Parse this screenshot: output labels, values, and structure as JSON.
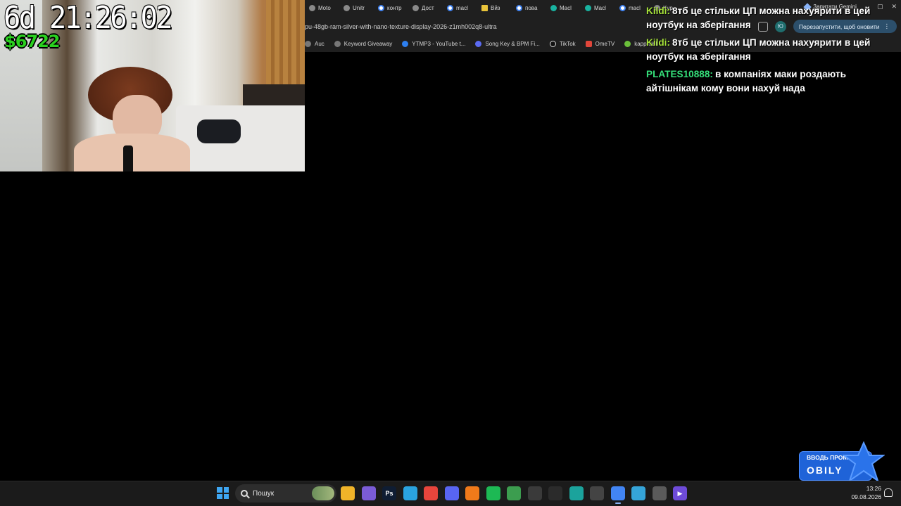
{
  "browser": {
    "tabs": [
      {
        "label": "Moto",
        "icon": "generic-favicon-icon",
        "style": "default"
      },
      {
        "label": "Unitr",
        "icon": "generic-favicon-icon",
        "style": "default"
      },
      {
        "label": "контр",
        "icon": "google-favicon-icon",
        "style": "g"
      },
      {
        "label": "Дост",
        "icon": "generic-favicon-icon",
        "style": "default"
      },
      {
        "label": "macl",
        "icon": "google-favicon-icon",
        "style": "g"
      },
      {
        "label": "Вйз",
        "icon": "doc-favicon-icon",
        "style": "sq"
      },
      {
        "label": "пова",
        "icon": "google-favicon-icon",
        "style": "g"
      },
      {
        "label": "Macl",
        "icon": "chatgpt-favicon-icon",
        "style": "teal"
      },
      {
        "label": "Macl",
        "icon": "chatgpt-favicon-icon",
        "style": "teal"
      },
      {
        "label": "macl",
        "icon": "google-favicon-icon",
        "style": "g"
      },
      {
        "label": "Kyp",
        "icon": "generic-favicon-icon",
        "style": "default"
      }
    ],
    "gemini_button": "Запитати Gemini",
    "url": "pu-48gb-ram-silver-with-nano-texture-display-2026-z1mh002q8-ultra",
    "profile_initial": "Ю",
    "restart_button": "Перезапустити, щоб оновити",
    "bookmarks": [
      {
        "label": "Auc",
        "icon_style": "default"
      },
      {
        "label": "Keyword Giveaway",
        "icon_style": "default"
      },
      {
        "label": "YTMP3 - YouTube t...",
        "icon_style": "blue"
      },
      {
        "label": "Song Key & BPM Fi...",
        "icon_style": "purple"
      },
      {
        "label": "TikTok",
        "icon_style": "tt"
      },
      {
        "label": "OmeTV",
        "icon_style": "red"
      },
      {
        "label": "kappa.lol",
        "icon_style": "green"
      }
    ]
  },
  "stream_overlay": {
    "timer": "6d 21:26:02",
    "money": "$6722"
  },
  "chat": [
    {
      "user": "Kildi:",
      "user_color": "#a6e23a",
      "text": "8тб це стільки ЦП можна нахуярити в цей ноутбук на зберігання"
    },
    {
      "user": "Kildi:",
      "user_color": "#a6e23a",
      "text": "8тб це стільки ЦП можна нахуярити в цей ноутбук на зберігання"
    },
    {
      "user": "PLATES10888:",
      "user_color": "#35e07a",
      "text": "в компаніях маки роздають айтішнікам кому вони нахуй нада"
    }
  ],
  "promo": {
    "line1": "ВВОДЬ ПРОМ",
    "line2": "OBILY"
  },
  "taskbar": {
    "search_placeholder": "Пошук",
    "apps": [
      {
        "name": "file-explorer-icon",
        "color": "#f0b429",
        "glyph": ""
      },
      {
        "name": "app-purple-icon",
        "color": "#7b5cd6",
        "glyph": ""
      },
      {
        "name": "photoshop-icon",
        "color": "#0f1d33",
        "glyph": "Ps"
      },
      {
        "name": "telegram-icon",
        "color": "#2aa3df",
        "glyph": ""
      },
      {
        "name": "chrome-icon",
        "color": "#e8453c",
        "glyph": ""
      },
      {
        "name": "discord-icon",
        "color": "#5865f2",
        "glyph": ""
      },
      {
        "name": "fl-studio-icon",
        "color": "#f07a1a",
        "glyph": ""
      },
      {
        "name": "spotify-icon",
        "color": "#1db954",
        "glyph": ""
      },
      {
        "name": "chrome-profile-icon",
        "color": "#3c9d4f",
        "glyph": ""
      },
      {
        "name": "obs-icon",
        "color": "#3a3a3a",
        "glyph": ""
      },
      {
        "name": "capcut-icon",
        "color": "#2b2b2b",
        "glyph": ""
      },
      {
        "name": "edge-icon",
        "color": "#1ba39c",
        "glyph": ""
      },
      {
        "name": "terminal-icon",
        "color": "#444444",
        "glyph": ""
      },
      {
        "name": "chrome-active-icon",
        "color": "#4285f4",
        "glyph": ""
      },
      {
        "name": "telegram-desktop-icon",
        "color": "#35a4d8",
        "glyph": ""
      },
      {
        "name": "calculator-icon",
        "color": "#5a5a5a",
        "glyph": ""
      },
      {
        "name": "media-player-icon",
        "color": "#6e4bd8",
        "glyph": "▶"
      }
    ],
    "time": "13:26",
    "date": "09.08.2026"
  }
}
